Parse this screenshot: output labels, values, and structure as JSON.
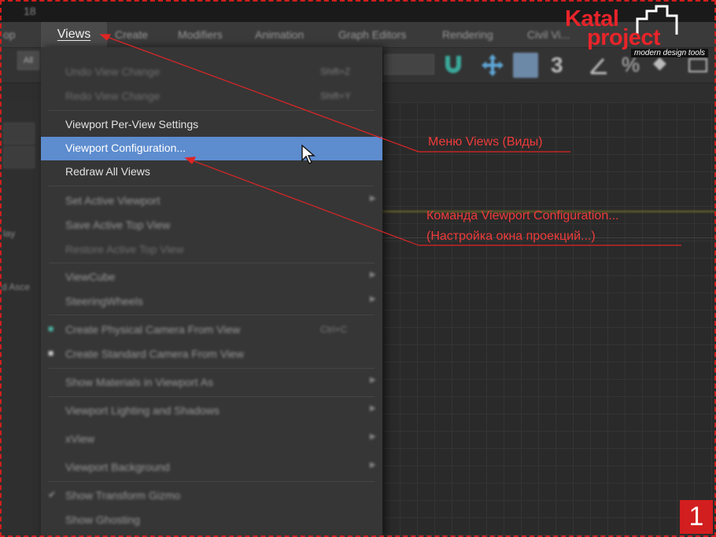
{
  "title_bar": {
    "text": "18"
  },
  "menubar": {
    "items": [
      "op",
      "Views",
      "Create",
      "Modifiers",
      "Animation",
      "Graph Editors",
      "Rendering",
      "Civil Vi..."
    ],
    "active": "Views"
  },
  "toolbar": {
    "all_label": "All",
    "three_label": "3"
  },
  "left_panel": {
    "labels": [
      "lay",
      "d Asce"
    ]
  },
  "views_menu": {
    "items": [
      {
        "label": "Undo View Change",
        "shortcut": "Shift+Z",
        "state": "disabled"
      },
      {
        "label": "Redo View Change",
        "shortcut": "Shift+Y",
        "state": "disabled"
      },
      {
        "label": "Viewport Per-View Settings",
        "state": "normal"
      },
      {
        "label": "Viewport Configuration...",
        "state": "highlighted"
      },
      {
        "label": "Redraw All Views",
        "state": "normal"
      },
      {
        "label": "Set Active Viewport",
        "state": "blurred",
        "submenu": true
      },
      {
        "label": "Save Active Top View",
        "state": "blurred"
      },
      {
        "label": "Restore Active Top View",
        "state": "disabled"
      },
      {
        "label": "ViewCube",
        "state": "blurred",
        "submenu": true
      },
      {
        "label": "SteeringWheels",
        "state": "blurred",
        "submenu": true
      },
      {
        "label": "Create Physical Camera From View",
        "shortcut": "Ctrl+C",
        "state": "blurred",
        "icon": "camera-icon"
      },
      {
        "label": "Create Standard Camera From View",
        "state": "blurred",
        "icon": "camera-icon"
      },
      {
        "label": "Show Materials in Viewport As",
        "state": "blurred",
        "submenu": true
      },
      {
        "label": "Viewport Lighting and Shadows",
        "state": "blurred",
        "submenu": true
      },
      {
        "label": "xView",
        "state": "blurred",
        "submenu": true
      },
      {
        "label": "Viewport Background",
        "state": "blurred",
        "submenu": true
      },
      {
        "label": "Show Transform Gizmo",
        "state": "blurred",
        "checked": true
      },
      {
        "label": "Show Ghosting",
        "state": "blurred"
      }
    ]
  },
  "logo": {
    "line1": "Katal",
    "line2": "project",
    "tagline": "modern design tools"
  },
  "annotations": {
    "menu_note": "Меню Views (Виды)",
    "command_note_1": "Команда Viewport Configuration...",
    "command_note_2": "(Настройка окна проекций...)"
  },
  "step_badge": "1",
  "colors": {
    "highlight": "#5d8ccf",
    "annotation": "#f03a3a",
    "frame": "#d21e1e"
  }
}
